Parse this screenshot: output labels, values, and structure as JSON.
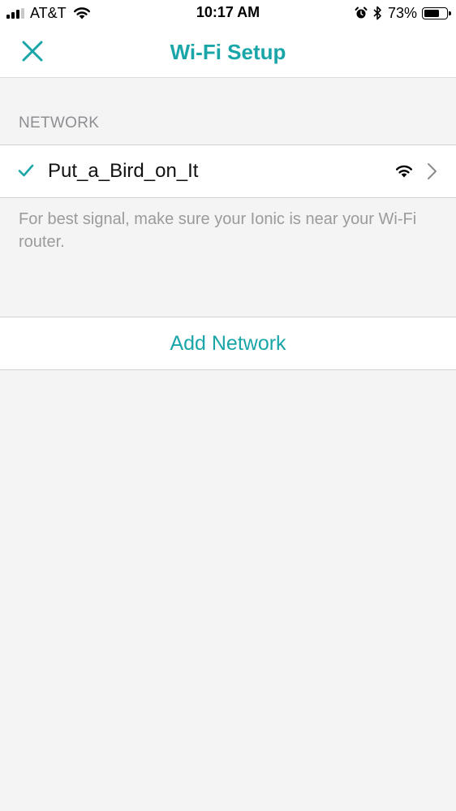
{
  "theme": {
    "accent": "#1aa6a8",
    "page_background": "#f4f4f4",
    "hint_color": "#9b9b9b"
  },
  "status_bar": {
    "carrier": "AT&T",
    "time": "10:17 AM",
    "battery_percent": "73%",
    "battery_level": 0.73,
    "signal_bars": 3,
    "signal_bars_total": 4,
    "icons": [
      "signal-bars-icon",
      "wifi-icon",
      "alarm-icon",
      "bluetooth-icon",
      "battery-icon"
    ]
  },
  "nav": {
    "title": "Wi-Fi Setup",
    "close_icon": "close-icon"
  },
  "section": {
    "header": "NETWORK"
  },
  "network": {
    "name": "Put_a_Bird_on_It",
    "selected": true,
    "icons": [
      "checkmark-icon",
      "wifi-signal-icon",
      "chevron-right-icon"
    ]
  },
  "hint": {
    "text": "For best signal, make sure your Ionic is near your Wi-Fi router."
  },
  "add_network": {
    "label": "Add Network"
  }
}
